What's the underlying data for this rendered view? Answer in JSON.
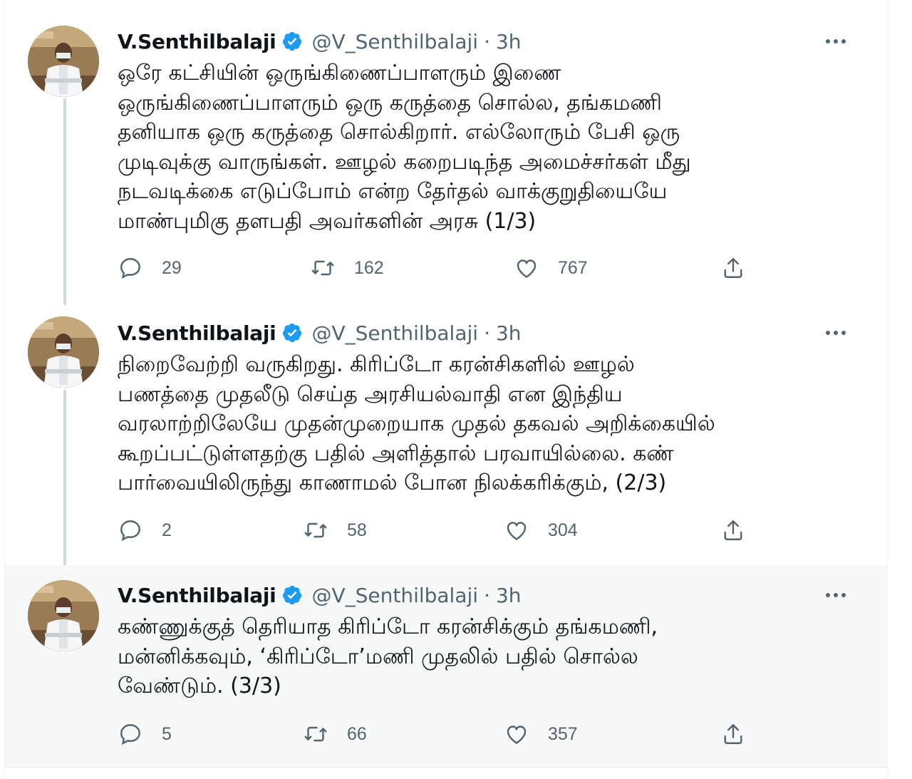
{
  "colors": {
    "verified_blue": "#1d9bf0",
    "secondary_text": "#536471",
    "primary_text": "#0f1419",
    "thread_line": "#cfd9de",
    "highlight_bg": "#f7f9f9"
  },
  "icons": {
    "reply": "reply-icon",
    "retweet": "retweet-icon",
    "like": "heart-icon",
    "share": "share-icon",
    "verified": "verified-badge-icon",
    "more": "more-options-icon"
  },
  "tweets": [
    {
      "author_name": "V.Senthilbalaji",
      "handle": "@V_Senthilbalaji",
      "separator": "·",
      "time": "3h",
      "text_lines": [
        "ஒரே கட்சியின் ஒருங்கிணைப்பாளரும் இணை",
        "ஒருங்கிணைப்பாளரும் ஒரு கருத்தை சொல்ல, தங்கமணி",
        "தனியாக ஒரு கருத்தை சொல்கிறார். எல்லோரும் பேசி ஒரு",
        "முடிவுக்கு வாருங்கள். ஊழல் கறைபடிந்த அமைச்சர்கள் மீது",
        "நடவடிக்கை எடுப்போம் என்ற தேர்தல் வாக்குறுதியையே",
        "மாண்புமிகு தளபதி அவர்களின் அரசு  (1/3)"
      ],
      "replies": "29",
      "retweets": "162",
      "likes": "767"
    },
    {
      "author_name": "V.Senthilbalaji",
      "handle": "@V_Senthilbalaji",
      "separator": "·",
      "time": "3h",
      "text_lines": [
        "நிறைவேற்றி வருகிறது. கிரிப்டோ கரன்சிகளில் ஊழல்",
        "பணத்தை முதலீடு செய்த அரசியல்வாதி என இந்திய",
        "வரலாற்றிலேயே முதன்முறையாக முதல் தகவல் அறிக்கையில்",
        "கூறப்பட்டுள்ளதற்கு பதில் அளித்தால் பரவாயில்லை.  கண்",
        "பார்வையிலிருந்து காணாமல் போன நிலக்கரிக்கும், (2/3)"
      ],
      "replies": "2",
      "retweets": "58",
      "likes": "304"
    },
    {
      "author_name": "V.Senthilbalaji",
      "handle": "@V_Senthilbalaji",
      "separator": "·",
      "time": "3h",
      "text_lines": [
        "கண்ணுக்குத் தெரியாத கிரிப்டோ கரன்சிக்கும் தங்கமணி,",
        "மன்னிக்கவும், ‘கிரிப்டோ’மணி முதலில் பதில் சொல்ல",
        "வேண்டும். (3/3)"
      ],
      "replies": "5",
      "retweets": "66",
      "likes": "357"
    }
  ]
}
